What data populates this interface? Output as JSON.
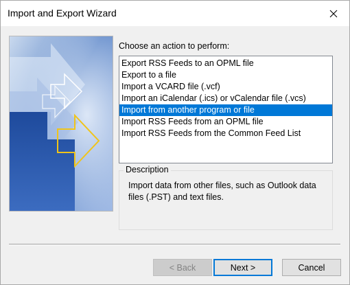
{
  "window": {
    "title": "Import and Export Wizard"
  },
  "prompt": "Choose an action to perform:",
  "actions": [
    {
      "label": "Export RSS Feeds to an OPML file",
      "selected": false
    },
    {
      "label": "Export to a file",
      "selected": false
    },
    {
      "label": "Import a VCARD file (.vcf)",
      "selected": false
    },
    {
      "label": "Import an iCalendar (.ics) or vCalendar file (.vcs)",
      "selected": false
    },
    {
      "label": "Import from another program or file",
      "selected": true
    },
    {
      "label": "Import RSS Feeds from an OPML file",
      "selected": false
    },
    {
      "label": "Import RSS Feeds from the Common Feed List",
      "selected": false
    }
  ],
  "description": {
    "legend": "Description",
    "text": "Import data from other files, such as Outlook data files (.PST) and text files."
  },
  "buttons": {
    "back": "< Back",
    "next": "Next >",
    "cancel": "Cancel"
  },
  "colors": {
    "selection": "#0078d7",
    "accent_blue": "#2a5fb0"
  },
  "icons": {
    "close": "close-icon",
    "graphic": "wizard-arrows-graphic"
  }
}
